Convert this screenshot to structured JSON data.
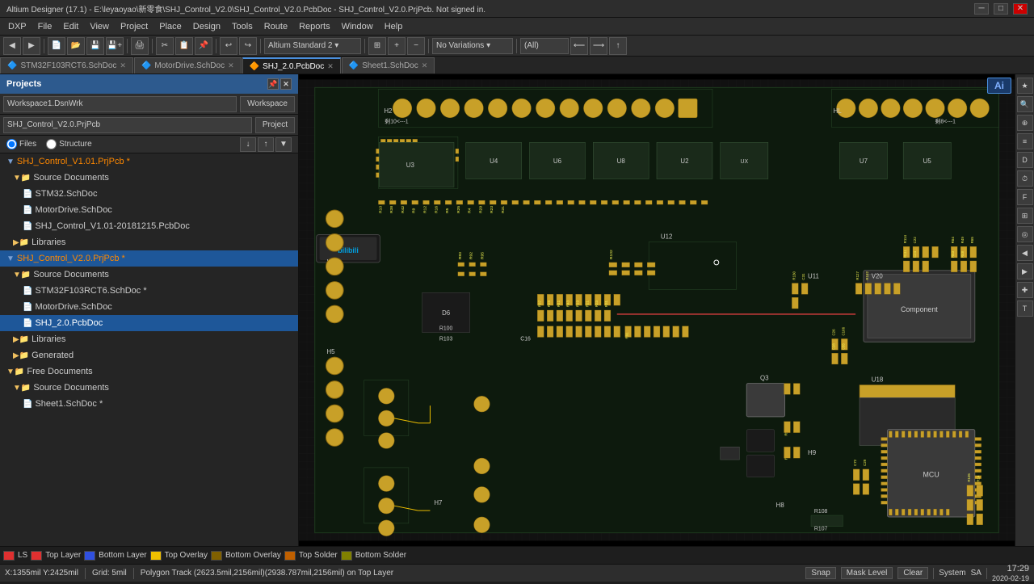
{
  "titlebar": {
    "title": "Altium Designer (17.1) - E:\\leyaoyao\\新零食\\SHJ_Control_V2.0\\SHJ_Control_V2.0.PcbDoc - SHJ_Control_V2.0.PrjPcb. Not signed in.",
    "min": "─",
    "max": "□",
    "close": "✕"
  },
  "menubar": {
    "items": [
      "DXP",
      "File",
      "Edit",
      "View",
      "Project",
      "Place",
      "Design",
      "Tools",
      "Route",
      "Reports",
      "Window",
      "Help"
    ]
  },
  "toolbar": {
    "workspace_label": "Altium Standard 2 ▾",
    "no_variations": "No Variations ▾",
    "all": "(All)"
  },
  "tabs": [
    {
      "label": "STM32F103RCT6.SchDoc",
      "active": false,
      "icon": "🔷"
    },
    {
      "label": "MotorDrive.SchDoc",
      "active": false,
      "icon": "🔷"
    },
    {
      "label": "SHJ_2.0.PcbDoc",
      "active": true,
      "icon": "🔶"
    },
    {
      "label": "Sheet1.SchDoc",
      "active": false,
      "icon": "🔷"
    }
  ],
  "left_panel": {
    "title": "Projects",
    "workspace_value": "Workspace1.DsnWrk",
    "workspace_btn": "Workspace",
    "project_value": "SHJ_Control_V2.0.PrjPcb",
    "project_btn": "Project",
    "view_files": "Files",
    "view_structure": "Structure"
  },
  "tree": [
    {
      "label": "SHJ_Control_V1.01.PrjPcb *",
      "level": 0,
      "type": "project",
      "expanded": true,
      "highlight": true
    },
    {
      "label": "Source Documents",
      "level": 1,
      "type": "folder",
      "expanded": true
    },
    {
      "label": "STM32.SchDoc",
      "level": 2,
      "type": "file"
    },
    {
      "label": "MotorDrive.SchDoc",
      "level": 2,
      "type": "file"
    },
    {
      "label": "SHJ_Control_V1.01-20181215.PcbDoc",
      "level": 2,
      "type": "file"
    },
    {
      "label": "Libraries",
      "level": 1,
      "type": "folder",
      "expanded": false
    },
    {
      "label": "SHJ_Control_V2.0.PrjPcb *",
      "level": 0,
      "type": "project",
      "expanded": true,
      "highlight": true,
      "selected": true
    },
    {
      "label": "Source Documents",
      "level": 1,
      "type": "folder",
      "expanded": true
    },
    {
      "label": "STM32F103RCT6.SchDoc *",
      "level": 2,
      "type": "file"
    },
    {
      "label": "MotorDrive.SchDoc",
      "level": 2,
      "type": "file"
    },
    {
      "label": "SHJ_2.0.PcbDoc",
      "level": 2,
      "type": "file",
      "selected": true
    },
    {
      "label": "Libraries",
      "level": 1,
      "type": "folder",
      "expanded": false
    },
    {
      "label": "Generated",
      "level": 1,
      "type": "folder",
      "expanded": false
    },
    {
      "label": "Free Documents",
      "level": 0,
      "type": "folder",
      "expanded": true
    },
    {
      "label": "Source Documents",
      "level": 1,
      "type": "folder",
      "expanded": true
    },
    {
      "label": "Sheet1.SchDoc *",
      "level": 2,
      "type": "file"
    }
  ],
  "statusbar": {
    "coords": "X:1355mil Y:2425mil",
    "grid": "Grid: 5mil",
    "track_info": "Polygon Track (2623.5mil,2156mil)(2938.787mil,2156mil) on Top Layer",
    "snap": "Snap",
    "mask_level": "Mask Level",
    "clear": "Clear",
    "system": "System",
    "sa": "SA",
    "time": "17:29",
    "date": "2020-02-19",
    "ls_label": "LS"
  },
  "layers": [
    {
      "color": "#e03030",
      "label": "LS"
    },
    {
      "color": "#e03030",
      "label": "Top Layer"
    },
    {
      "color": "#3050e0",
      "label": "Bottom Layer"
    },
    {
      "color": "#f0c000",
      "label": "Top Overlay"
    },
    {
      "color": "#806000",
      "label": "Bottom Overlay"
    },
    {
      "color": "#c06000",
      "label": "Top Solder"
    },
    {
      "color": "#808000",
      "label": "Bottom Solder"
    }
  ],
  "ai_btn": "Ai",
  "right_sidebar": {
    "icons": [
      "F",
      "C",
      "K",
      "W",
      "3",
      "G",
      "X",
      "S",
      "T",
      "U"
    ]
  }
}
